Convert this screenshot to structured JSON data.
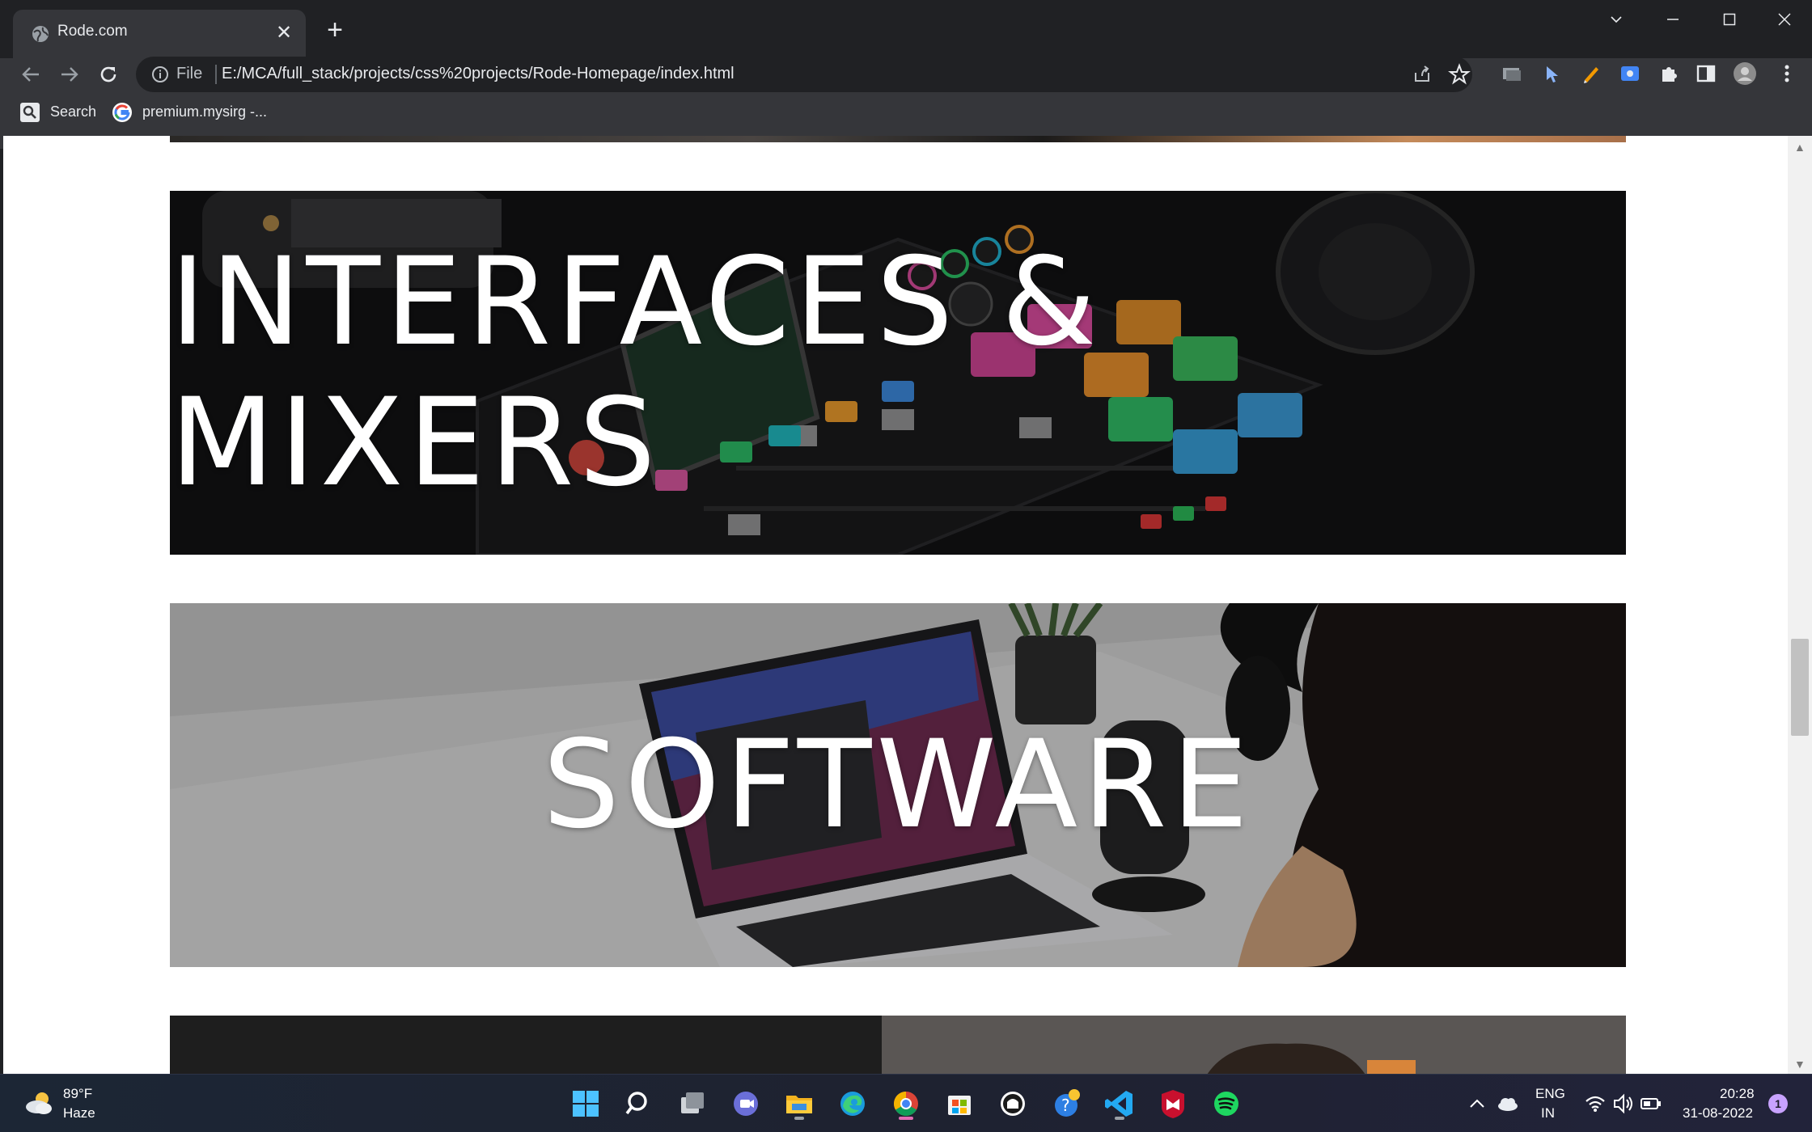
{
  "browser": {
    "tab_title": "Rode.com",
    "close_tab_glyph": "✕",
    "new_tab_glyph": "+",
    "omnibox": {
      "scheme_label": "File",
      "url": "E:/MCA/full_stack/projects/css%20projects/Rode-Homepage/index.html"
    },
    "bookmarks": [
      {
        "label": "Search",
        "icon": "search-icon"
      },
      {
        "label": "premium.mysirg -...",
        "icon": "google-icon"
      }
    ],
    "window_controls": [
      "chevron-down-icon",
      "minimize-icon",
      "maximize-icon",
      "close-icon"
    ]
  },
  "page": {
    "banners": [
      {
        "title": "INTERFACES & MIXERS",
        "theme": "dark"
      },
      {
        "title": "SOFTWARE",
        "theme": "light"
      }
    ]
  },
  "taskbar": {
    "weather": {
      "temp": "89°F",
      "condition": "Haze"
    },
    "apps": [
      "windows-start-icon",
      "search-icon",
      "task-view-icon",
      "teams-chat-icon",
      "file-explorer-icon",
      "edge-icon",
      "chrome-icon",
      "microsoft-store-icon",
      "github-icon",
      "help-icon",
      "vscode-icon",
      "mcafee-icon",
      "spotify-icon"
    ],
    "tray": {
      "lang_line1": "ENG",
      "lang_line2": "IN"
    },
    "clock": {
      "time": "20:28",
      "date": "31-08-2022"
    },
    "notifications": "1"
  },
  "colors": {
    "chrome_dark": "#202124",
    "chrome_toolbar": "#35363a",
    "page_bg": "#ffffff",
    "banner_text": "#ffffff"
  }
}
